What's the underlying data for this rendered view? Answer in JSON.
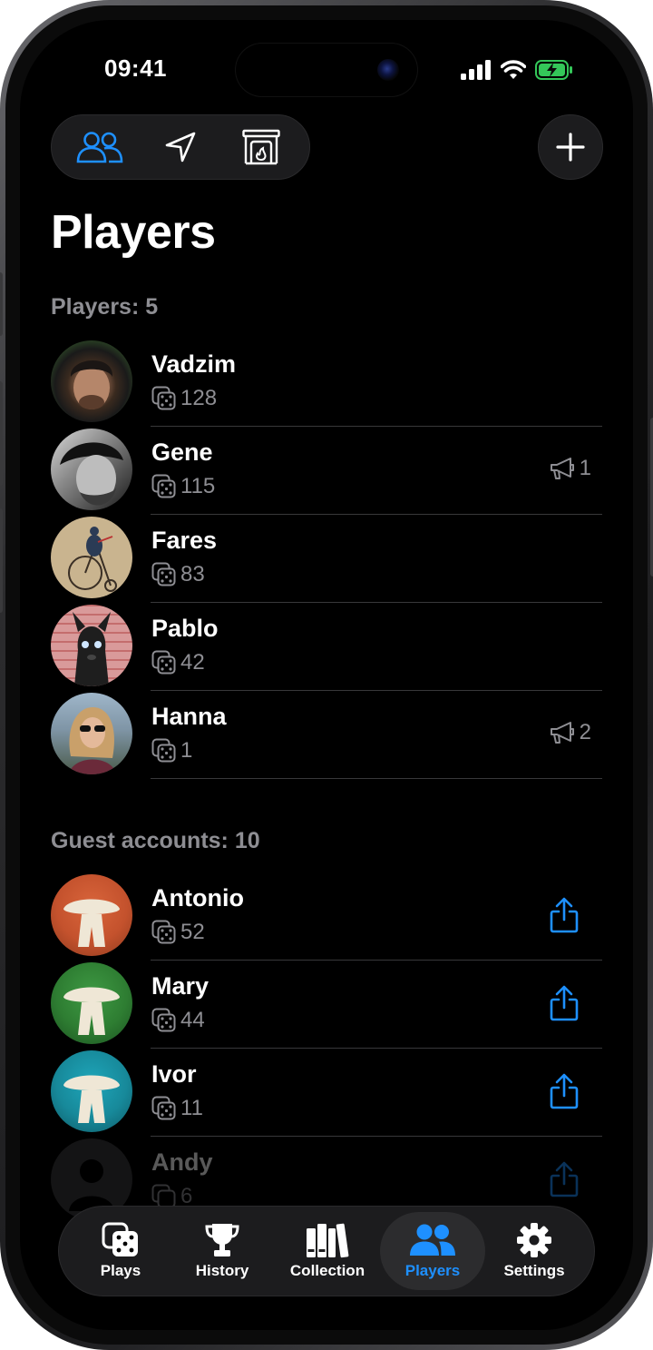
{
  "status": {
    "time": "09:41"
  },
  "colors": {
    "accent": "#1e90ff",
    "background": "#000000",
    "secondary_text": "#8e8e93",
    "battery": "#34c759"
  },
  "toolbar": {
    "items": [
      {
        "icon": "people-icon",
        "active": true
      },
      {
        "icon": "location-arrow-icon",
        "active": false
      },
      {
        "icon": "fireplace-icon",
        "active": false
      }
    ],
    "add_icon": "plus-icon"
  },
  "title": "Players",
  "players_section": {
    "header": "Players: 5",
    "items": [
      {
        "name": "Vadzim",
        "plays": "128",
        "badge": ""
      },
      {
        "name": "Gene",
        "plays": "115",
        "badge": "1"
      },
      {
        "name": "Fares",
        "plays": "83",
        "badge": ""
      },
      {
        "name": "Pablo",
        "plays": "42",
        "badge": ""
      },
      {
        "name": "Hanna",
        "plays": "1",
        "badge": "2"
      }
    ]
  },
  "guests_section": {
    "header": "Guest accounts: 10",
    "items": [
      {
        "name": "Antonio",
        "plays": "52",
        "color": "#c4522d"
      },
      {
        "name": "Mary",
        "plays": "44",
        "color": "#2e7d32"
      },
      {
        "name": "Ivor",
        "plays": "11",
        "color": "#17899a"
      },
      {
        "name": "Andy",
        "plays": "6",
        "color": "#3a3a3c"
      }
    ]
  },
  "tabbar": {
    "tabs": [
      {
        "label": "Plays",
        "icon": "dice-icon"
      },
      {
        "label": "History",
        "icon": "trophy-icon"
      },
      {
        "label": "Collection",
        "icon": "books-icon"
      },
      {
        "label": "Players",
        "icon": "people-icon",
        "active": true
      },
      {
        "label": "Settings",
        "icon": "gear-icon"
      }
    ]
  }
}
